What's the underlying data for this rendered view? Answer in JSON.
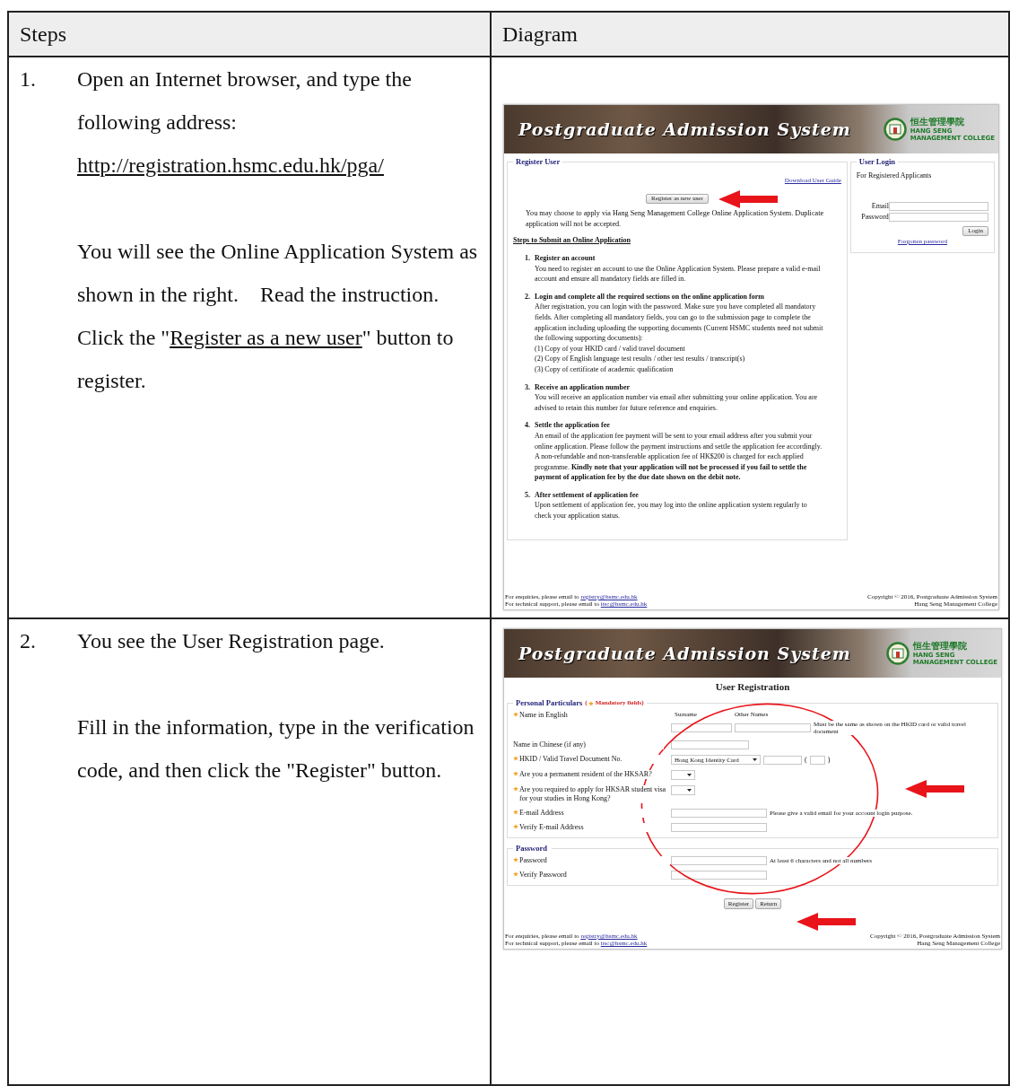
{
  "table": {
    "columns": [
      "Steps",
      "Diagram"
    ],
    "rows": [
      {
        "number": "1.",
        "blocks": [
          [
            {
              "kind": "text",
              "text": "Open an Internet browser, and type the following address: "
            },
            {
              "kind": "link",
              "text": "http://registration.hsmc.edu.hk/pga/"
            }
          ],
          [
            {
              "kind": "text",
              "text": "You will see the Online Application System as shown in the right.　Read the instruction.　Click the \""
            },
            {
              "kind": "underline",
              "text": "Register as a new user"
            },
            {
              "kind": "text",
              "text": "\" button to register."
            }
          ]
        ],
        "screenshot": {
          "kind": "home",
          "banner": {
            "title": "Postgraduate Admission System",
            "college_zh": "恒生管理學院",
            "college_en": [
              "HANG SENG",
              "MANAGEMENT COLLEGE"
            ]
          },
          "register_panel": {
            "legend": "Register User",
            "guide_link": "Download User Guide",
            "button": "Register as new user",
            "notice": "You may choose to apply via Hang Seng Management College Online Application System. Duplicate application will not be accepted.",
            "steps_heading": "Steps to Submit an Online Application",
            "steps": [
              {
                "number": "1.",
                "title": "Register an account",
                "body": [
                  "You need to register an account to use the Online Application System. Please prepare a valid e-mail account and ensure all mandatory fields are filled in."
                ]
              },
              {
                "number": "2.",
                "title": "Login and complete all the required sections on the online application form",
                "body": [
                  "After registration, you can login with the password. Make sure you have completed all mandatory fields. After completing all mandatory fields, you can go to the submission page to complete the application including uploading the supporting documents (Current HSMC students need not submit the following supporting documents):",
                  "(1) Copy of your HKID card / valid travel document",
                  "(2) Copy of English language test results / other test results / transcript(s)",
                  "(3) Copy of certificate of academic qualification"
                ]
              },
              {
                "number": "3.",
                "title": "Receive an application number",
                "body": [
                  "You will receive an application number via email after submitting your online application. You are advised to retain this number for future reference and enquiries."
                ]
              },
              {
                "number": "4.",
                "title": "Settle the application fee",
                "body": [
                  "An email of the application fee payment will be sent to your email address after you submit your online application. Please follow the payment instructions and settle the application fee accordingly. A non-refundable and non-transferable application fee of HK$200 is charged for each applied programme. **Kindly note that your application will not be processed if you fail to settle the payment of application fee by the due date shown on the debit note.**"
                ]
              },
              {
                "number": "5.",
                "title": "After settlement of application fee",
                "body": [
                  "Upon settlement of application fee, you may log into the online application system regularly to check your application status."
                ]
              }
            ]
          },
          "login_panel": {
            "legend": "User Login",
            "subtitle": "For Registered Applicants",
            "fields": [
              "Email",
              "Password"
            ],
            "button": "Login",
            "forgot_link": "Forgotten password"
          },
          "footer": {
            "left": [
              {
                "text": "For enquiries, please email to ",
                "link": "registry@hsmc.edu.hk"
              },
              {
                "text": "For technical support, please email to ",
                "link": "itsc@hsmc.edu.hk"
              }
            ],
            "right": [
              "Copyright © 2016, Postgraduate Admission System",
              "Hang Seng Management College"
            ]
          }
        }
      },
      {
        "number": "2.",
        "blocks": [
          [
            {
              "kind": "text",
              "text": "You see the User Registration page."
            }
          ],
          [
            {
              "kind": "text",
              "text": "Fill in the information, type in the verification code, and then click the \"Register\" button."
            }
          ]
        ],
        "screenshot": {
          "kind": "registration",
          "banner": {
            "title": "Postgraduate Admission System",
            "college_zh": "恒生管理學院",
            "college_en": [
              "HANG SENG",
              "MANAGEMENT COLLEGE"
            ]
          },
          "title": "User Registration",
          "sections": [
            {
              "legend": "Personal Particulars",
              "note": {
                "prefix": "(",
                "text": "Mandatory fields)"
              },
              "fields": [
                {
                  "kind": "name",
                  "label": "Name in English",
                  "mandatory": true,
                  "headings": [
                    "Surname",
                    "Other Names"
                  ],
                  "hint": "Must be the same as shown on the HKID card or valid travel document"
                },
                {
                  "kind": "text",
                  "label": "Name in Chinese (if any)",
                  "mandatory": false
                },
                {
                  "kind": "document",
                  "label": "HKID / Valid Travel Document No.",
                  "mandatory": true,
                  "select": "Hong Kong Identity Card",
                  "brackets": [
                    "(",
                    ")"
                  ]
                },
                {
                  "kind": "select",
                  "label": "Are you a permanent resident of the HKSAR?",
                  "mandatory": true
                },
                {
                  "kind": "select",
                  "label": "Are you required to apply for HKSAR student visa for your studies in Hong Kong?",
                  "mandatory": true
                },
                {
                  "kind": "text",
                  "label": "E-mail Address",
                  "mandatory": true,
                  "hint": "Please give a valid email for your account login purpose."
                },
                {
                  "kind": "text",
                  "label": "Verify E-mail Address",
                  "mandatory": true
                }
              ]
            },
            {
              "legend": "Password",
              "fields": [
                {
                  "kind": "text",
                  "label": "Password",
                  "mandatory": true,
                  "hint": "At least 6 characters and not all numbers"
                },
                {
                  "kind": "text",
                  "label": "Verify Password",
                  "mandatory": true
                }
              ]
            }
          ],
          "buttons": [
            "Register",
            "Return"
          ],
          "footer": {
            "left": [
              {
                "text": "For enquiries, please email to ",
                "link": "registry@hsmc.edu.hk"
              },
              {
                "text": "For technical support, please email to ",
                "link": "itsc@hsmc.edu.hk"
              }
            ],
            "right": [
              "Copyright © 2016, Postgraduate Admission System",
              "Hang Seng Management College"
            ]
          }
        }
      }
    ]
  }
}
